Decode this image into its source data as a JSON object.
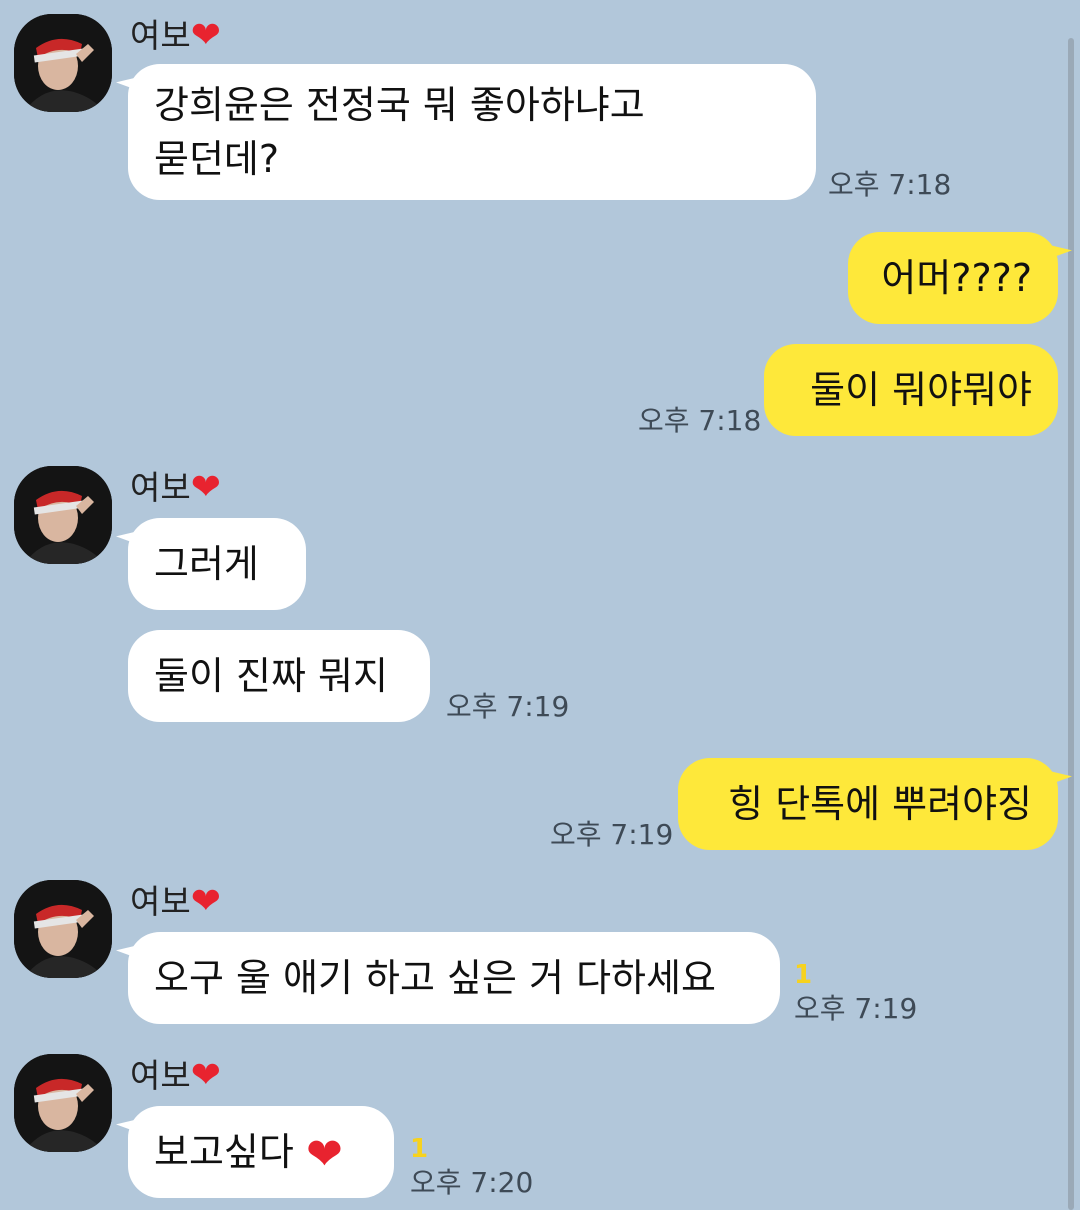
{
  "chat": {
    "partner_name": "여보",
    "name_heart": "❤",
    "groups": [
      {
        "messages": [
          "강희윤은 전정국 뭐 좋아하냐고",
          "묻던데?"
        ],
        "time": "오후 7:18"
      },
      {
        "messages": [
          "어머????",
          "둘이 뭐야뭐야"
        ],
        "time": "오후 7:18"
      },
      {
        "messages": [
          "그러게",
          "둘이 진짜 뭐지"
        ],
        "time": "오후 7:19"
      },
      {
        "messages": [
          "힝 단톡에 뿌려야징"
        ],
        "time": "오후 7:19"
      },
      {
        "messages": [
          "오구 울 애기 하고 싶은 거 다하세요"
        ],
        "time": "오후 7:19",
        "unread": "1"
      },
      {
        "messages": [
          "보고싶다"
        ],
        "emoji": "❤",
        "time": "오후 7:20",
        "unread": "1"
      }
    ]
  }
}
